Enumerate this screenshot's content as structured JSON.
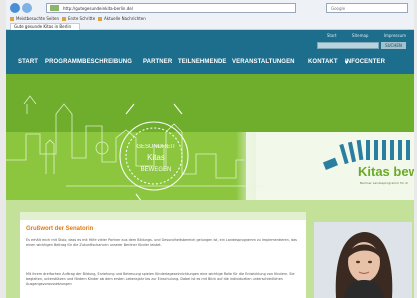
{
  "browser": {
    "url": "http://gutegesundeinkita-berlin.de/",
    "search_placeholder": "Google",
    "bookmarks": [
      "Meistbesuchte Seiten",
      "Erste Schritte",
      "Aktuelle Nachrichten"
    ],
    "tab_title": "Gute gesunde Kitas in Berlin"
  },
  "site": {
    "util_links": [
      "Start",
      "Sitemap",
      "Impressum"
    ],
    "search_button": "SUCHEN",
    "nav": [
      "START",
      "PROGRAMMBESCHREIBUNG",
      "PARTNER",
      "TEILNEHMENDE",
      "VERANSTALTUNGEN",
      "KONTAKT",
      "INFOCENTER"
    ],
    "nav_dropdown_icon": "chevron-down-icon",
    "hero_stamp_text": [
      "GESUNDHEIT",
      "Kitas",
      "BEWEGEN"
    ],
    "logo_text": "Kitas bew",
    "logo_sub": "Berliner Landesprogramm für di"
  },
  "content": {
    "title": "Grußwort der Senatorin",
    "para1": "Es erhält mich mit Stolz, dass es mit Hilfe vieler Partner aus dem Bildungs- und Gesundheitsbereich gelungen ist, ein Landesprogramm zu implementieren, das einen wichtigen Beitrag für die Zukunftschancen unserer Berliner Kinder leistet.",
    "para2": "Mit ihrem dreifachen Auftrag der Bildung, Erziehung und Betreuung spielen Kindertageseinrichtungen eine wichtige Rolle für die Entwicklung von Kindern. Sie begleiten, unterstützen und fördern Kinder ab dem ersten Lebensjahr bis zur Einschulung. Dabei ist es mit Blick auf die individuellen unterschiedlichen Ausgangsvoraussetzungen"
  },
  "colors": {
    "header": "#1d6d8c",
    "hero_green": "#8cc63f",
    "accent_orange": "#e07a10"
  }
}
